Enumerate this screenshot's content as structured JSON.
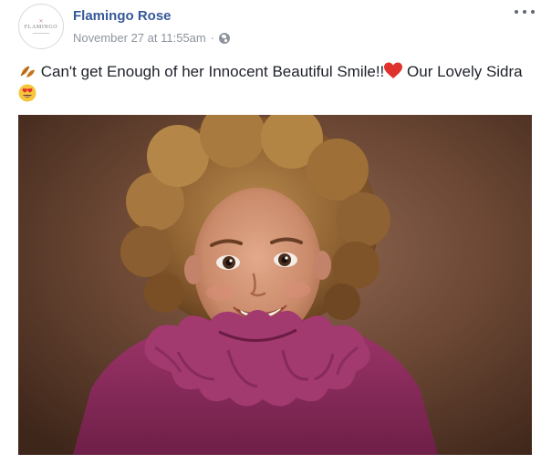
{
  "post": {
    "author": "Flamingo Rose",
    "timestamp": "November 27 at 11:55am",
    "separator": "·",
    "privacy_icon": "globe-icon",
    "avatar_logo_text": "FLAMINGO",
    "text_part_1": "Can't get Enough of her Innocent Beautiful Smile!!",
    "text_part_2": "Our Lovely Sidra",
    "photo_alt": "Portrait of a smiling curly-haired girl in a purple ruffled sweater"
  },
  "colors": {
    "author_link": "#365899",
    "meta_gray": "#8d949e",
    "text": "#1d2129",
    "background_brown": "#6d4a36",
    "sweater_purple": "#8b2b5c",
    "heart_red": "#e0322c"
  },
  "icons": [
    "leaves-emoji-icon",
    "red-heart-icon",
    "heart-eyes-emoji-icon",
    "globe-icon",
    "more-options-icon"
  ]
}
